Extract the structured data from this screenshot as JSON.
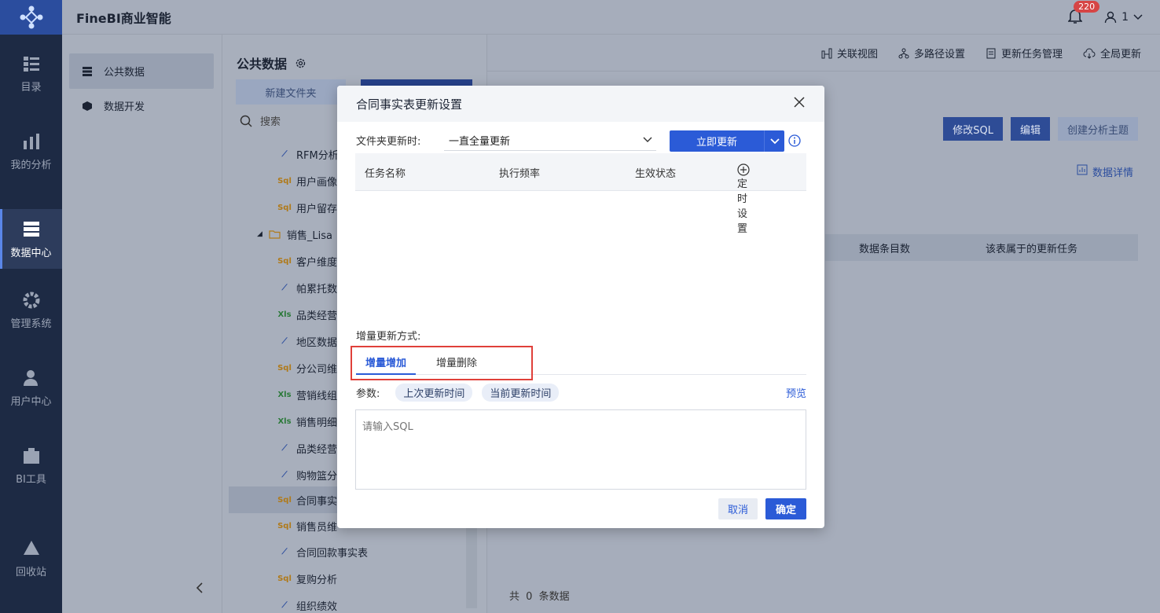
{
  "app": {
    "title": "FineBI商业智能"
  },
  "header": {
    "notification_count": "220",
    "user_name": "1"
  },
  "nav": {
    "items": [
      {
        "label": "目录",
        "icon": "catalog-icon"
      },
      {
        "label": "我的分析",
        "icon": "chart-icon"
      },
      {
        "label": "数据中心",
        "icon": "database-icon",
        "active": true
      },
      {
        "label": "管理系统",
        "icon": "gear-icon"
      },
      {
        "label": "用户中心",
        "icon": "user-icon"
      },
      {
        "label": "BI工具",
        "icon": "toolbox-icon"
      },
      {
        "label": "回收站",
        "icon": "recycle-icon"
      }
    ]
  },
  "sidebar": {
    "items": [
      {
        "label": "公共数据",
        "icon": "list-icon",
        "active": true
      },
      {
        "label": "数据开发",
        "icon": "cube-icon"
      }
    ]
  },
  "tree": {
    "title": "公共数据",
    "new_folder": "新建文件夹",
    "search_placeholder": "搜索",
    "rows": [
      {
        "type": "chart",
        "label": "RFM分析"
      },
      {
        "type": "sql",
        "label": "用户画像"
      },
      {
        "type": "sql",
        "label": "用户留存"
      },
      {
        "type": "folder",
        "label": "销售_Lisa"
      },
      {
        "type": "sql",
        "label": "客户维度"
      },
      {
        "type": "chart",
        "label": "帕累托数"
      },
      {
        "type": "xls",
        "label": "品类经营"
      },
      {
        "type": "chart",
        "label": "地区数据"
      },
      {
        "type": "sql",
        "label": "分公司维"
      },
      {
        "type": "xls",
        "label": "营销线组"
      },
      {
        "type": "xls",
        "label": "销售明细"
      },
      {
        "type": "chart",
        "label": "品类经营"
      },
      {
        "type": "chart",
        "label": "购物篮分"
      },
      {
        "type": "sql",
        "label": "合同事实"
      },
      {
        "type": "sql",
        "label": "销售员维"
      },
      {
        "type": "chart",
        "label": "合同回款事实表"
      },
      {
        "type": "sql",
        "label": "复购分析"
      },
      {
        "type": "chart",
        "label": "组织绩效"
      }
    ]
  },
  "main": {
    "toolbar": [
      "关联视图",
      "多路径设置",
      "更新任务管理",
      "全局更新"
    ],
    "buttons": {
      "edit_sql": "修改SQL",
      "edit": "编辑",
      "create_topic": "创建分析主题"
    },
    "detail_link": "数据详情",
    "table_headers": [
      "数据条目数",
      "该表属于的更新任务"
    ],
    "footer": {
      "prefix": "共",
      "count": "0",
      "suffix": "条数据"
    }
  },
  "modal": {
    "title": "合同事实表更新设置",
    "folder_update_label": "文件夹更新时:",
    "folder_update_value": "一直全量更新",
    "update_now": "立即更新",
    "table": {
      "col_name": "任务名称",
      "col_freq": "执行频率",
      "col_status": "生效状态",
      "timer": "定时设置"
    },
    "incremental_label": "增量更新方式:",
    "tabs": [
      "增量增加",
      "增量删除"
    ],
    "params_label": "参数:",
    "params": [
      "上次更新时间",
      "当前更新时间"
    ],
    "preview": "预览",
    "sql_placeholder": "请输入SQL",
    "cancel": "取消",
    "ok": "确定"
  }
}
